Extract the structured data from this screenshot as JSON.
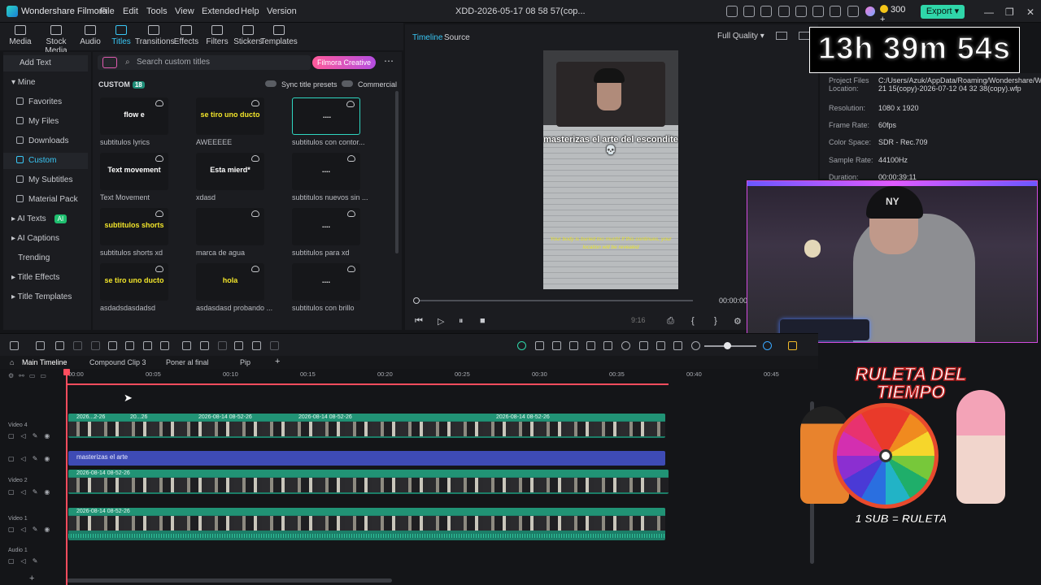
{
  "app": {
    "name": "Wondershare Filmora",
    "doc_title": "XDD-2026-05-17 08 58 57(cop..."
  },
  "menu": [
    "File",
    "Edit",
    "Tools",
    "View",
    "Extended",
    "Help",
    "Version"
  ],
  "header": {
    "credits": "300",
    "export_label": "Export"
  },
  "media_tabs": [
    {
      "label": "Media",
      "icon": "media-icon"
    },
    {
      "label": "Stock Media",
      "icon": "stock-media-icon"
    },
    {
      "label": "Audio",
      "icon": "audio-icon"
    },
    {
      "label": "Titles",
      "icon": "titles-icon"
    },
    {
      "label": "Transitions",
      "icon": "transitions-icon"
    },
    {
      "label": "Effects",
      "icon": "effects-icon"
    },
    {
      "label": "Filters",
      "icon": "filters-icon"
    },
    {
      "label": "Stickers",
      "icon": "stickers-icon"
    },
    {
      "label": "Templates",
      "icon": "templates-icon"
    }
  ],
  "sidebar": {
    "add_text": "Add Text",
    "mine": "Mine",
    "items": [
      "Favorites",
      "My Files",
      "Downloads",
      "Custom",
      "My Subtitles",
      "Material Pack"
    ],
    "sections": [
      "AI Texts",
      "AI Captions",
      "Trending",
      "Title Effects",
      "Title Templates"
    ],
    "ai_badge": "AI"
  },
  "search": {
    "placeholder": "Search custom titles",
    "promo": "Filmora Creative"
  },
  "custom": {
    "label": "CUSTOM",
    "count": "18",
    "sync_label": "Sync title presets",
    "commercial_label": "Commercial"
  },
  "titles": [
    {
      "label": "subtitulos lyrics",
      "preview": "flow e",
      "color": "#ffffff"
    },
    {
      "label": "AWEEEEE",
      "preview": "se tiro uno ducto",
      "color": "#f2e52a"
    },
    {
      "label": "subtitulos con contor...",
      "preview": "....",
      "color": "#ffffff"
    },
    {
      "label": "Text Movement",
      "preview": "Text movement",
      "color": "#ffffff"
    },
    {
      "label": "xdasd",
      "preview": "Esta mierd*",
      "color": "#ffffff"
    },
    {
      "label": "subtitulos nuevos sin ...",
      "preview": "....",
      "color": "#ffffff"
    },
    {
      "label": "subtitulos shorts xd",
      "preview": "subtitulos shorts",
      "color": "#f2e52a"
    },
    {
      "label": "marca de agua",
      "preview": "",
      "color": "#ffffff"
    },
    {
      "label": "subtitulos para xd",
      "preview": "....",
      "color": "#ffffff"
    },
    {
      "label": "asdadsdasdadsd",
      "preview": "se tiro uno ducto",
      "color": "#f2e52a"
    },
    {
      "label": "asdasdasd probando ...",
      "preview": "hola",
      "color": "#f2e52a"
    },
    {
      "label": "subtitulos con brillo",
      "preview": "....",
      "color": "#ffffff"
    }
  ],
  "player": {
    "tab_timeline": "Timeline",
    "tab_source": "Source",
    "quality": "Full Quality",
    "caption": "masterizas el arte del escondite 💀",
    "game_sub": "Your body is buried too much! If this continues, your location will be revealed",
    "timecode": "00:00:00:0",
    "ratio": "9:16"
  },
  "timer": {
    "text": "13h 39m 54s"
  },
  "project_info": [
    {
      "key": "Project Files Location:",
      "value": "C:/Users/Azuk/AppData/Roaming/Wondershare/Wo...06 21 15(copy)-2026-07-12 04 32 38(copy).wfp"
    },
    {
      "key": "Resolution:",
      "value": "1080 x 1920"
    },
    {
      "key": "Frame Rate:",
      "value": "60fps"
    },
    {
      "key": "Color Space:",
      "value": "SDR - Rec.709"
    },
    {
      "key": "Sample Rate:",
      "value": "44100Hz"
    },
    {
      "key": "Duration:",
      "value": "00:00:39:11"
    }
  ],
  "timeline_tabs": [
    "Main Timeline",
    "Compound Clip 3",
    "Poner al final",
    "Pip"
  ],
  "ruler": [
    "00:00",
    "00:05",
    "00:10",
    "00:15",
    "00:20",
    "00:25",
    "00:30",
    "00:35",
    "00:40",
    "00:45"
  ],
  "tracks": {
    "video4_label": "Video 4",
    "video2_label": "Video 2",
    "video1_label": "Video 1",
    "audio1_label": "Audio 1",
    "v4_clips": [
      "2026...2-26",
      "20...26",
      "2026-08-14 08-52-26",
      "2026-08-14 08-52-26",
      "2026-08-14 08-52-26"
    ],
    "title_clip": "masterizas el arte",
    "v2_clip": "2026-08-14 08-52-26",
    "v1_clip": "2026-08-14 08-52-26"
  },
  "overlay": {
    "ruleta_title": "RULETA DEL TIEMPO",
    "ruleta_sub": "1 SUB = RULETA"
  }
}
